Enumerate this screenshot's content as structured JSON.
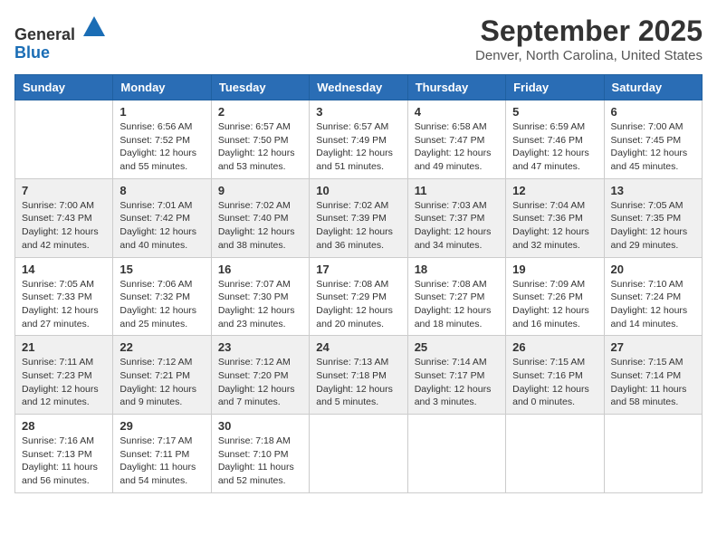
{
  "header": {
    "logo_general": "General",
    "logo_blue": "Blue",
    "month": "September 2025",
    "location": "Denver, North Carolina, United States"
  },
  "weekdays": [
    "Sunday",
    "Monday",
    "Tuesday",
    "Wednesday",
    "Thursday",
    "Friday",
    "Saturday"
  ],
  "weeks": [
    [
      {
        "day": "",
        "sunrise": "",
        "sunset": "",
        "daylight": ""
      },
      {
        "day": "1",
        "sunrise": "Sunrise: 6:56 AM",
        "sunset": "Sunset: 7:52 PM",
        "daylight": "Daylight: 12 hours and 55 minutes."
      },
      {
        "day": "2",
        "sunrise": "Sunrise: 6:57 AM",
        "sunset": "Sunset: 7:50 PM",
        "daylight": "Daylight: 12 hours and 53 minutes."
      },
      {
        "day": "3",
        "sunrise": "Sunrise: 6:57 AM",
        "sunset": "Sunset: 7:49 PM",
        "daylight": "Daylight: 12 hours and 51 minutes."
      },
      {
        "day": "4",
        "sunrise": "Sunrise: 6:58 AM",
        "sunset": "Sunset: 7:47 PM",
        "daylight": "Daylight: 12 hours and 49 minutes."
      },
      {
        "day": "5",
        "sunrise": "Sunrise: 6:59 AM",
        "sunset": "Sunset: 7:46 PM",
        "daylight": "Daylight: 12 hours and 47 minutes."
      },
      {
        "day": "6",
        "sunrise": "Sunrise: 7:00 AM",
        "sunset": "Sunset: 7:45 PM",
        "daylight": "Daylight: 12 hours and 45 minutes."
      }
    ],
    [
      {
        "day": "7",
        "sunrise": "Sunrise: 7:00 AM",
        "sunset": "Sunset: 7:43 PM",
        "daylight": "Daylight: 12 hours and 42 minutes."
      },
      {
        "day": "8",
        "sunrise": "Sunrise: 7:01 AM",
        "sunset": "Sunset: 7:42 PM",
        "daylight": "Daylight: 12 hours and 40 minutes."
      },
      {
        "day": "9",
        "sunrise": "Sunrise: 7:02 AM",
        "sunset": "Sunset: 7:40 PM",
        "daylight": "Daylight: 12 hours and 38 minutes."
      },
      {
        "day": "10",
        "sunrise": "Sunrise: 7:02 AM",
        "sunset": "Sunset: 7:39 PM",
        "daylight": "Daylight: 12 hours and 36 minutes."
      },
      {
        "day": "11",
        "sunrise": "Sunrise: 7:03 AM",
        "sunset": "Sunset: 7:37 PM",
        "daylight": "Daylight: 12 hours and 34 minutes."
      },
      {
        "day": "12",
        "sunrise": "Sunrise: 7:04 AM",
        "sunset": "Sunset: 7:36 PM",
        "daylight": "Daylight: 12 hours and 32 minutes."
      },
      {
        "day": "13",
        "sunrise": "Sunrise: 7:05 AM",
        "sunset": "Sunset: 7:35 PM",
        "daylight": "Daylight: 12 hours and 29 minutes."
      }
    ],
    [
      {
        "day": "14",
        "sunrise": "Sunrise: 7:05 AM",
        "sunset": "Sunset: 7:33 PM",
        "daylight": "Daylight: 12 hours and 27 minutes."
      },
      {
        "day": "15",
        "sunrise": "Sunrise: 7:06 AM",
        "sunset": "Sunset: 7:32 PM",
        "daylight": "Daylight: 12 hours and 25 minutes."
      },
      {
        "day": "16",
        "sunrise": "Sunrise: 7:07 AM",
        "sunset": "Sunset: 7:30 PM",
        "daylight": "Daylight: 12 hours and 23 minutes."
      },
      {
        "day": "17",
        "sunrise": "Sunrise: 7:08 AM",
        "sunset": "Sunset: 7:29 PM",
        "daylight": "Daylight: 12 hours and 20 minutes."
      },
      {
        "day": "18",
        "sunrise": "Sunrise: 7:08 AM",
        "sunset": "Sunset: 7:27 PM",
        "daylight": "Daylight: 12 hours and 18 minutes."
      },
      {
        "day": "19",
        "sunrise": "Sunrise: 7:09 AM",
        "sunset": "Sunset: 7:26 PM",
        "daylight": "Daylight: 12 hours and 16 minutes."
      },
      {
        "day": "20",
        "sunrise": "Sunrise: 7:10 AM",
        "sunset": "Sunset: 7:24 PM",
        "daylight": "Daylight: 12 hours and 14 minutes."
      }
    ],
    [
      {
        "day": "21",
        "sunrise": "Sunrise: 7:11 AM",
        "sunset": "Sunset: 7:23 PM",
        "daylight": "Daylight: 12 hours and 12 minutes."
      },
      {
        "day": "22",
        "sunrise": "Sunrise: 7:12 AM",
        "sunset": "Sunset: 7:21 PM",
        "daylight": "Daylight: 12 hours and 9 minutes."
      },
      {
        "day": "23",
        "sunrise": "Sunrise: 7:12 AM",
        "sunset": "Sunset: 7:20 PM",
        "daylight": "Daylight: 12 hours and 7 minutes."
      },
      {
        "day": "24",
        "sunrise": "Sunrise: 7:13 AM",
        "sunset": "Sunset: 7:18 PM",
        "daylight": "Daylight: 12 hours and 5 minutes."
      },
      {
        "day": "25",
        "sunrise": "Sunrise: 7:14 AM",
        "sunset": "Sunset: 7:17 PM",
        "daylight": "Daylight: 12 hours and 3 minutes."
      },
      {
        "day": "26",
        "sunrise": "Sunrise: 7:15 AM",
        "sunset": "Sunset: 7:16 PM",
        "daylight": "Daylight: 12 hours and 0 minutes."
      },
      {
        "day": "27",
        "sunrise": "Sunrise: 7:15 AM",
        "sunset": "Sunset: 7:14 PM",
        "daylight": "Daylight: 11 hours and 58 minutes."
      }
    ],
    [
      {
        "day": "28",
        "sunrise": "Sunrise: 7:16 AM",
        "sunset": "Sunset: 7:13 PM",
        "daylight": "Daylight: 11 hours and 56 minutes."
      },
      {
        "day": "29",
        "sunrise": "Sunrise: 7:17 AM",
        "sunset": "Sunset: 7:11 PM",
        "daylight": "Daylight: 11 hours and 54 minutes."
      },
      {
        "day": "30",
        "sunrise": "Sunrise: 7:18 AM",
        "sunset": "Sunset: 7:10 PM",
        "daylight": "Daylight: 11 hours and 52 minutes."
      },
      {
        "day": "",
        "sunrise": "",
        "sunset": "",
        "daylight": ""
      },
      {
        "day": "",
        "sunrise": "",
        "sunset": "",
        "daylight": ""
      },
      {
        "day": "",
        "sunrise": "",
        "sunset": "",
        "daylight": ""
      },
      {
        "day": "",
        "sunrise": "",
        "sunset": "",
        "daylight": ""
      }
    ]
  ]
}
